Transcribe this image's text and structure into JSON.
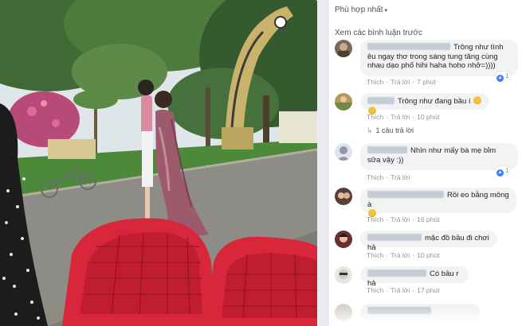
{
  "photo": {
    "description_icon": "photo-street-scene"
  },
  "comments_panel": {
    "sort_label": "Phù hợp nhất",
    "sort_caret": "▾",
    "view_previous": "Xem các bình luận trước",
    "actions": {
      "like": "Thích",
      "reply": "Trả lời",
      "dot": "·"
    },
    "comments": [
      {
        "text": "Trông như tình êu ngay thơ trong sáng tung tăng cùng nhau dạo phố hihi haha hoho nhở=))))",
        "time": "7 phút",
        "likes": "1",
        "emoji_count": 0
      },
      {
        "text": "Trông như đang bầu í",
        "time": "10 phút",
        "likes": "",
        "emoji_count": 2,
        "replies_label": "1 câu trả lời"
      },
      {
        "text": "Nhìn như mấy bà mẹ bỉm sữa vậy :))",
        "time": "",
        "likes": "1",
        "emoji_count": 0
      },
      {
        "text": "Rồi eo bằng mông à",
        "time": "16 phút",
        "likes": "",
        "emoji_count": 1
      },
      {
        "text": "mặc đồ bầu đi chơi hả",
        "time": "10 phút",
        "likes": "",
        "emoji_count": 0
      },
      {
        "text": "Có bầu r hả",
        "time": "17 phút",
        "likes": "",
        "emoji_count": 0
      }
    ]
  },
  "colors": {
    "page_bg": "#e9ebee",
    "bubble_bg": "#f2f3f5",
    "meta_text": "#90949c",
    "like_blue": "#4080ff",
    "chair_red": "#d8263a"
  }
}
